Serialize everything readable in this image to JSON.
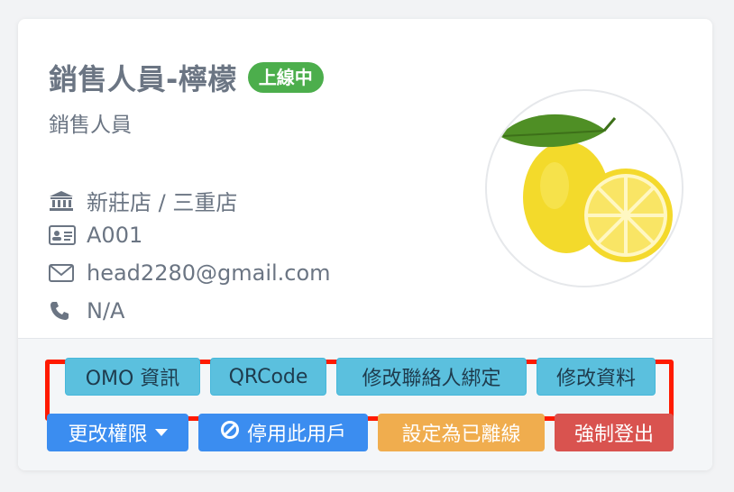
{
  "profile": {
    "name": "銷售人員-檸檬",
    "status_badge": "上線中",
    "role": "銷售人員",
    "stores": "新莊店 / 三重店",
    "employee_id": "A001",
    "email": "head2280@gmail.com",
    "phone": "N/A",
    "avatar": "lemon-illustration"
  },
  "actions": {
    "omo_info": "OMO 資訊",
    "qrcode": "QRCode",
    "edit_contact_binding": "修改聯絡人綁定",
    "edit_profile": "修改資料",
    "change_permission": "更改權限",
    "disable_account": "停用此用戶",
    "set_offline": "設定為已離線",
    "force_logout": "強制登出"
  },
  "colors": {
    "online_badge": "#4cae4c",
    "info_button": "#5bc0de",
    "primary_button": "#3b8df0",
    "warning_button": "#f0ad4e",
    "danger_button": "#d9534f",
    "highlight_border": "#ff1a00"
  },
  "icons": [
    "bank-icon",
    "id-card-icon",
    "envelope-icon",
    "phone-icon",
    "caret-down-icon",
    "ban-icon"
  ]
}
